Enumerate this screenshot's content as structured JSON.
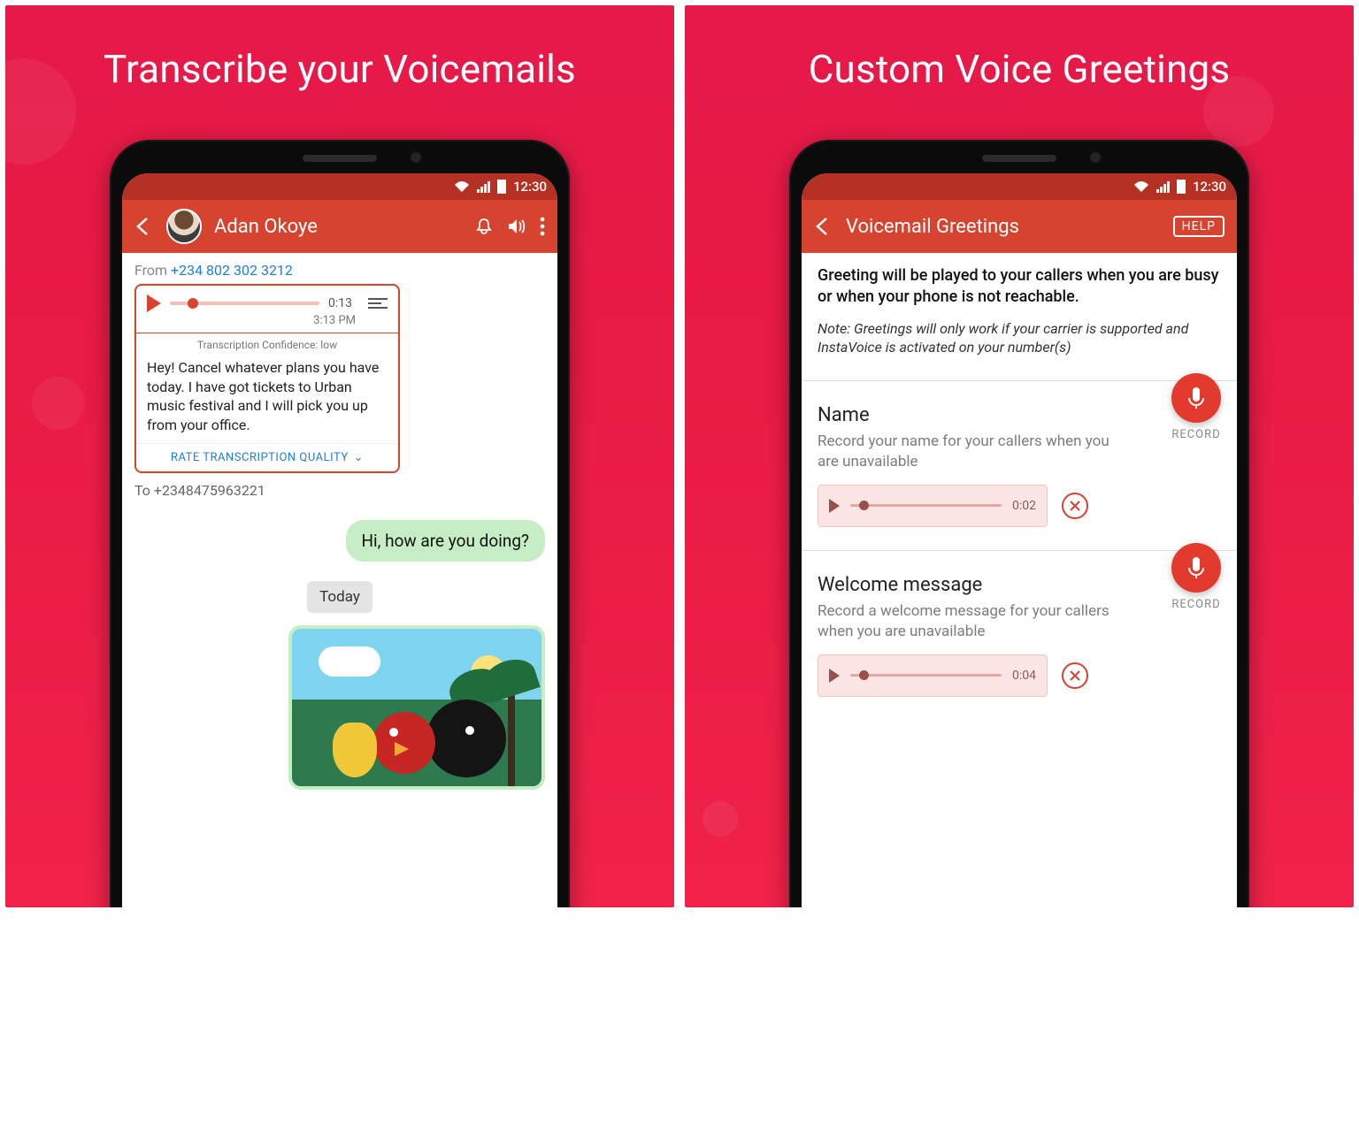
{
  "panels": {
    "left": {
      "title": "Transcribe your Voicemails"
    },
    "right": {
      "title": "Custom Voice Greetings"
    }
  },
  "status": {
    "time": "12:30"
  },
  "conv": {
    "appbar": {
      "contact": "Adan Okoye"
    },
    "from_label": "From ",
    "from_number": "+234 802 302 3212",
    "voicemail": {
      "duration": "0:13",
      "time": "3:13 PM",
      "confidence_label": "Transcription Confidence: low",
      "transcript": "Hey! Cancel whatever plans you have today. I have got tickets to Urban music festival and I will pick you up from your office.",
      "rate_label": "RATE TRANSCRIPTION QUALITY"
    },
    "to_line": "To +2348475963221",
    "outgoing_text": "Hi, how are you doing?",
    "date_pill": "Today"
  },
  "greet": {
    "appbar": {
      "title": "Voicemail Greetings",
      "help": "HELP"
    },
    "lead": "Greeting will be played to your callers when you are busy or when your phone is not reachable.",
    "note": "Note: Greetings will only work if your carrier is supported and InstaVoice is activated on your number(s)",
    "sections": [
      {
        "title": "Name",
        "sub": "Record your name for your callers when you are unavailable",
        "dur": "0:02",
        "rec": "RECORD"
      },
      {
        "title": "Welcome message",
        "sub": "Record a welcome message for your callers when you are unavailable",
        "dur": "0:04",
        "rec": "RECORD"
      }
    ]
  }
}
